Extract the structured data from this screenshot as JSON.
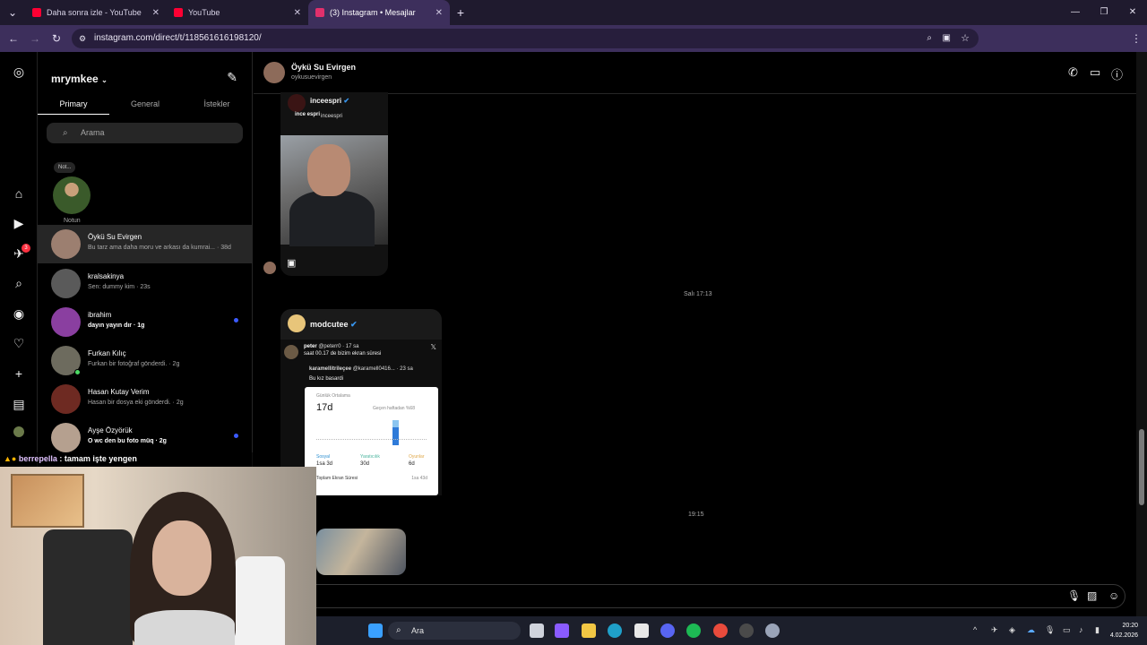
{
  "browser": {
    "tabs": [
      {
        "title": "Daha sonra izle - YouTube",
        "color": "#ff0033"
      },
      {
        "title": "YouTube",
        "color": "#ff0033"
      },
      {
        "title": "(3) Instagram • Mesajlar",
        "color": "#e1306c"
      }
    ],
    "new_tab": "+",
    "url": "instagram.com/direct/t/118561616198120/",
    "accent": "#3d2f5c"
  },
  "sidebar": {
    "username": "mrymkee",
    "tabs": [
      "Primary",
      "General",
      "İstekler"
    ],
    "active_tab": "Primary",
    "search_placeholder": "Arama",
    "note_bubble": "Not...",
    "note_label": "Notun",
    "notification_badge": "3",
    "conversations": [
      {
        "name": "Öykü Su Evirgen",
        "preview": "Bu tarz ama daha moru ve arkası da kumrai... · 38d",
        "unread": false,
        "selected": true
      },
      {
        "name": "kralsakinya",
        "preview": "Sen: dummy kim · 23s",
        "unread": false,
        "selected": false
      },
      {
        "name": "ibrahim",
        "preview": "dayın yayın dır · 1g",
        "unread": true,
        "selected": false
      },
      {
        "name": "Furkan Kılıç",
        "preview": "Furkan bir fotoğraf gönderdi. · 2g",
        "unread": false,
        "selected": false
      },
      {
        "name": "Hasan Kutay Verim",
        "preview": "Hasan bir dosya eki gönderdi. · 2g",
        "unread": false,
        "selected": false
      },
      {
        "name": "Ayşe Özyörük",
        "preview": "O wc den bu foto müq · 2g",
        "unread": true,
        "selected": false
      }
    ]
  },
  "chat": {
    "name": "Öykü Su Evirgen",
    "handle": "oykusuevirgen",
    "post1": {
      "account": "inceespri",
      "logo": "ince espri",
      "sub": "inceespri"
    },
    "timestamp1": "Salı 17:13",
    "post2": {
      "account": "modcutee",
      "tweet_user": "peter",
      "tweet_handle": "@peterr0 · 17 sa",
      "tweet_text": "saat 00.17 de bizim ekran süresi",
      "quote_user": "karamellitrileçee",
      "quote_handle": "@karamell0416... · 23 sa",
      "quote_text": "Bu kız basardi",
      "card_title": "Günlük Ortalama",
      "card_value": "17d",
      "card_compare": "Geçen haftadan %68",
      "card_labels": [
        "Sosyal",
        "Yaratıcılık",
        "Oyunlar"
      ],
      "card_values": [
        "1sa 3d",
        "30d",
        "6d"
      ],
      "card_total_label": "Toplam Ekran Süresi",
      "card_total_value": "1sa 43d"
    },
    "timestamp2": "19:15"
  },
  "stream_overlay": {
    "user": "berrepella",
    "message": ": tamam işte yengen"
  },
  "taskbar": {
    "search_label": "Ara",
    "time": "20:20",
    "date": "4.02.2026"
  }
}
